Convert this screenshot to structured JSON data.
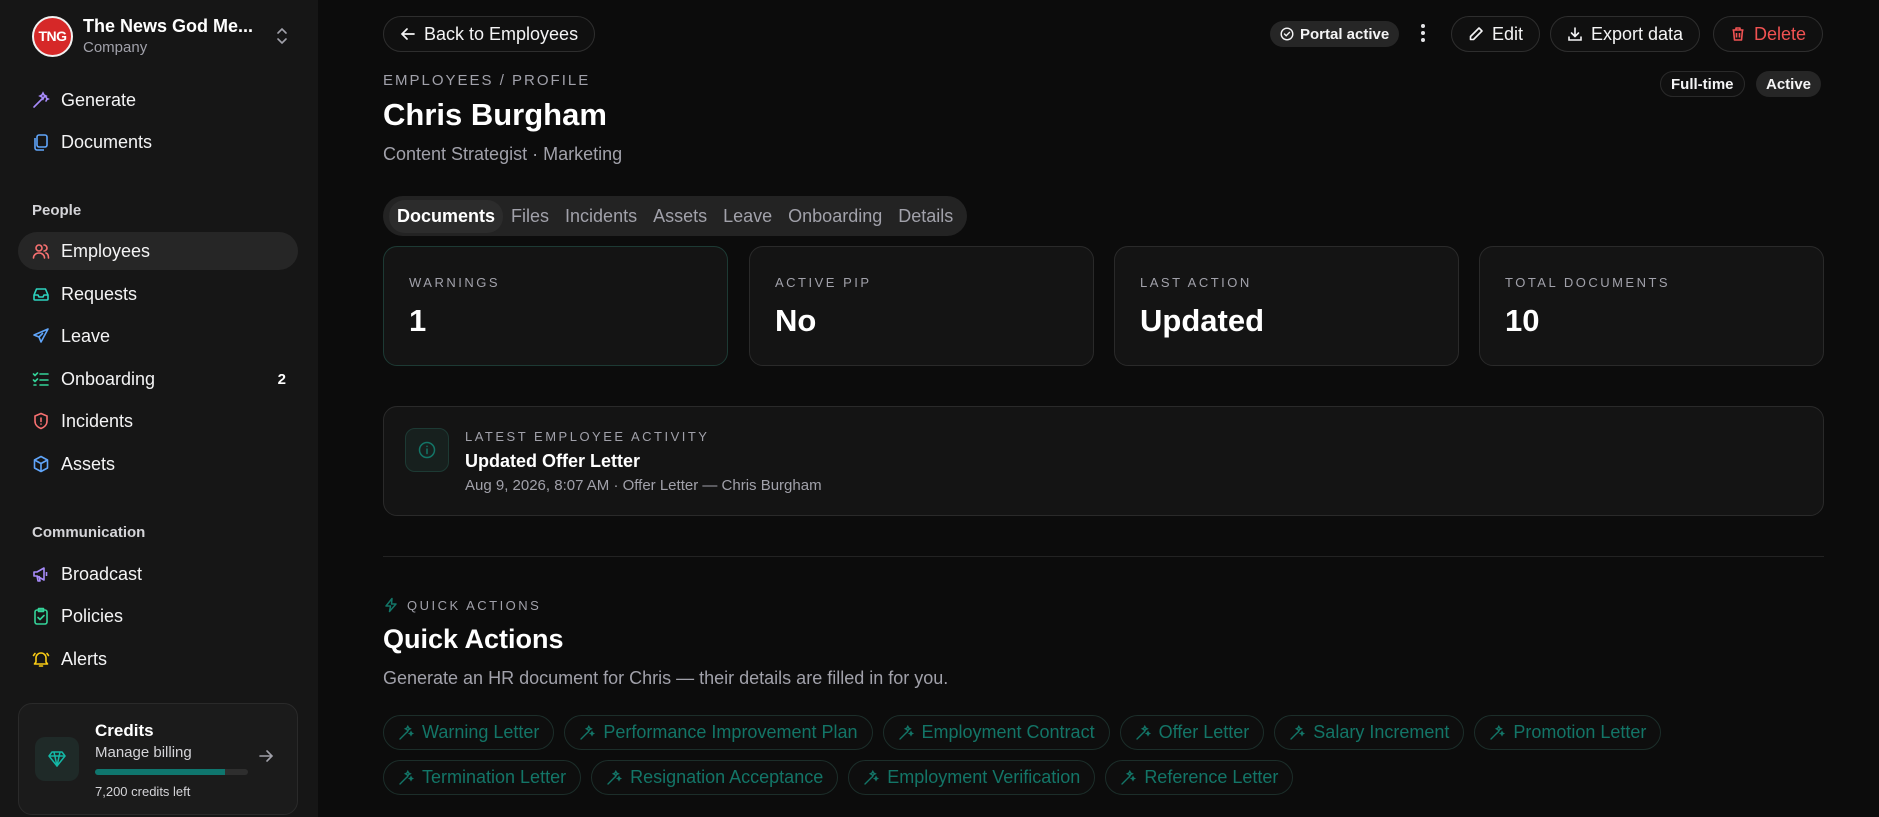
{
  "sidebar": {
    "brand": {
      "logo_text": "TNG",
      "name": "The News God Me...",
      "subtitle": "Company"
    },
    "top_items": [
      {
        "label": "Generate",
        "icon": "wand-icon"
      },
      {
        "label": "Documents",
        "icon": "documents-icon"
      }
    ],
    "people_section": "People",
    "people_items": [
      {
        "label": "Employees",
        "icon": "users-icon"
      },
      {
        "label": "Requests",
        "icon": "inbox-icon"
      },
      {
        "label": "Leave",
        "icon": "plane-icon"
      },
      {
        "label": "Onboarding",
        "icon": "checklist-icon",
        "badge": "2"
      },
      {
        "label": "Incidents",
        "icon": "shield-alert-icon"
      },
      {
        "label": "Assets",
        "icon": "box-icon"
      }
    ],
    "communication_section": "Communication",
    "communication_items": [
      {
        "label": "Broadcast",
        "icon": "megaphone-icon"
      },
      {
        "label": "Policies",
        "icon": "clipboard-check-icon"
      },
      {
        "label": "Alerts",
        "icon": "bell-icon"
      }
    ],
    "credits": {
      "title": "Credits",
      "subtitle": "Manage billing",
      "remaining": "7,200 credits left",
      "usage_fraction": 0.85
    }
  },
  "header": {
    "back_label": "Back to Employees",
    "portal_status": "Portal active",
    "edit_label": "Edit",
    "export_label": "Export data",
    "delete_label": "Delete"
  },
  "profile": {
    "breadcrumb": "EMPLOYEES / PROFILE",
    "name": "Chris Burgham",
    "role": "Content Strategist · Marketing",
    "employment_type": "Full-time",
    "status": "Active"
  },
  "tabs": [
    "Documents",
    "Files",
    "Incidents",
    "Assets",
    "Leave",
    "Onboarding",
    "Details"
  ],
  "stats": [
    {
      "label": "WARNINGS",
      "value": "1"
    },
    {
      "label": "ACTIVE PIP",
      "value": "No"
    },
    {
      "label": "LAST ACTION",
      "value": "Updated"
    },
    {
      "label": "TOTAL DOCUMENTS",
      "value": "10"
    }
  ],
  "activity": {
    "label": "LATEST EMPLOYEE ACTIVITY",
    "title": "Updated Offer Letter",
    "meta": "Aug 9, 2026, 8:07 AM · Offer Letter — Chris Burgham"
  },
  "quick_actions": {
    "eyebrow": "QUICK ACTIONS",
    "title": "Quick Actions",
    "description": "Generate an HR document for Chris — their details are filled in for you.",
    "items": [
      "Warning Letter",
      "Performance Improvement Plan",
      "Employment Contract",
      "Offer Letter",
      "Salary Increment",
      "Promotion Letter",
      "Termination Letter",
      "Resignation Acceptance",
      "Employment Verification",
      "Reference Letter"
    ]
  },
  "colors": {
    "accent": "#137567",
    "danger": "#f05252",
    "background": "#0c0c0c",
    "sidebar": "#161616"
  }
}
